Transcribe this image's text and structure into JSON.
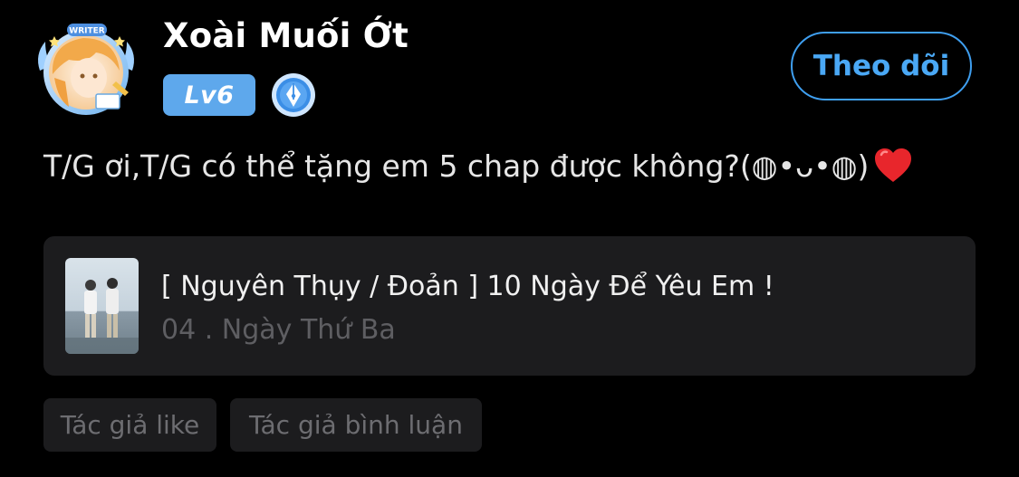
{
  "user": {
    "name": "Xoài Muối Ớt",
    "level": "Lv6",
    "avatar_frame_label": "WRITER",
    "follow_label": "Theo dõi"
  },
  "comment": {
    "text": "T/G ơi,T/G có thể tặng em 5 chap được không?(◍•ᴗ•◍)",
    "emoji": "red-heart-icon"
  },
  "story": {
    "title": "[ Nguyên Thụy / Đoản ] 10 Ngày Để Yêu Em !",
    "chapter": "04 . Ngày Thứ Ba"
  },
  "chips": {
    "author_like": "Tác giả like",
    "author_comment": "Tác giả bình luận"
  },
  "colors": {
    "background": "#000000",
    "accent": "#4aa8f5",
    "level_badge": "#5ea8ec",
    "card": "#1c1c1e",
    "muted_text": "#5e5e62"
  }
}
